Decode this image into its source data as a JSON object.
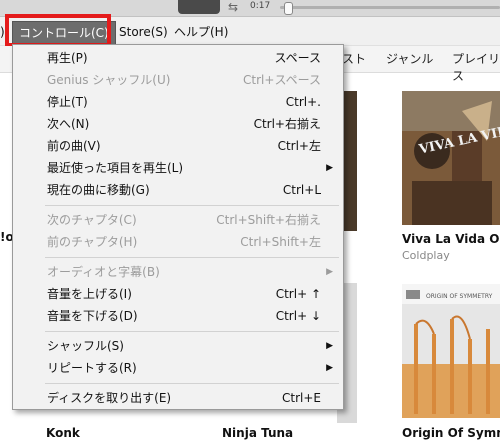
{
  "player": {
    "time": "0:17"
  },
  "menubar": {
    "edge_char": ")",
    "control": "コントロール(C)",
    "store": "Store(S)",
    "help": "ヘルプ(H)"
  },
  "tabs": [
    "スト",
    "ジャンル",
    "プレイリス"
  ],
  "left_edge_text": "!o",
  "albums": [
    {
      "title": "Viva La Vida Or",
      "artist": "Coldplay"
    },
    {
      "title": "Konk",
      "artist": ""
    },
    {
      "title": "Ninja Tuna",
      "artist": ""
    },
    {
      "title": "Origin Of Symm",
      "artist": ""
    }
  ],
  "album_art_text": {
    "viva": "VIVA LA VIDA",
    "origin": "ORIGIN OF SYMMETRY"
  },
  "menu": {
    "items": [
      {
        "label": "再生(P)",
        "shortcut": "スペース"
      },
      {
        "label": "Genius シャッフル(U)",
        "shortcut": "Ctrl+スペース"
      },
      {
        "label": "停止(T)",
        "shortcut": "Ctrl+."
      },
      {
        "label": "次へ(N)",
        "shortcut": "Ctrl+右揃え"
      },
      {
        "label": "前の曲(V)",
        "shortcut": "Ctrl+左"
      },
      {
        "label": "最近使った項目を再生(L)",
        "shortcut": ""
      },
      {
        "label": "現在の曲に移動(G)",
        "shortcut": "Ctrl+L"
      },
      {
        "label": "次のチャプタ(C)",
        "shortcut": "Ctrl+Shift+右揃え"
      },
      {
        "label": "前のチャプタ(H)",
        "shortcut": "Ctrl+Shift+左"
      },
      {
        "label": "オーディオと字幕(B)",
        "shortcut": ""
      },
      {
        "label": "音量を上げる(I)",
        "shortcut": "Ctrl+ ↑"
      },
      {
        "label": "音量を下げる(D)",
        "shortcut": "Ctrl+ ↓"
      },
      {
        "label": "シャッフル(S)",
        "shortcut": ""
      },
      {
        "label": "リピートする(R)",
        "shortcut": ""
      },
      {
        "label": "ディスクを取り出す(E)",
        "shortcut": "Ctrl+E"
      }
    ],
    "disabled": [
      1,
      7,
      8,
      9
    ],
    "submenu": [
      5,
      9,
      12,
      13
    ]
  },
  "colors": {
    "highlight_box": "#e41b1b",
    "menu_bg": "#f2f2f2",
    "disabled_text": "#9c9c9c",
    "active_menubar": "#6d6d6d"
  }
}
